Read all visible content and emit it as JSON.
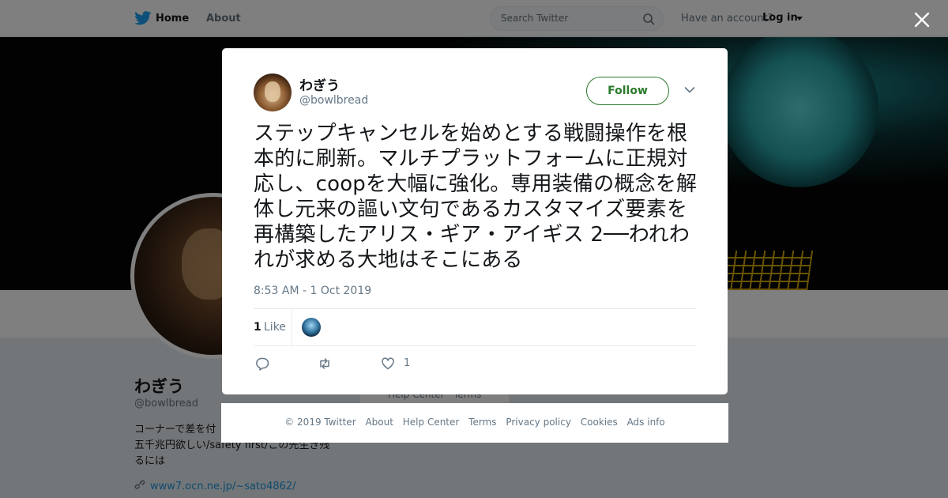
{
  "topbar": {
    "home_label": "Home",
    "about_label": "About",
    "search_placeholder": "Search Twitter",
    "account_question": "Have an account?",
    "login_label": "Log in"
  },
  "profile": {
    "name": "わぎう",
    "handle": "@bowlbread",
    "bio": "コーナーで差を付\n五千兆円欲しい/safety first/この先生き残\nるには",
    "link": "www7.ocn.ne.jp/~sato4862/",
    "card_links": "Help Center   Terms"
  },
  "tweet": {
    "author_name": "わぎう",
    "author_handle": "@bowlbread",
    "follow_label": "Follow",
    "text": "ステップキャンセルを始めとする戦闘操作を根本的に刷新。マルチプラットフォームに正規対応し、coopを大幅に強化。専用装備の概念を解体し元来の謳い文句であるカスタマイズ要素を再構築したアリス・ギア・アイギス 2──われわれが求める大地はそこにある",
    "timestamp": "8:53 AM - 1 Oct 2019",
    "like_count": "1",
    "like_label": "Like",
    "action_like_count": "1"
  },
  "footer": {
    "links": [
      "© 2019 Twitter",
      "About",
      "Help Center",
      "Terms",
      "Privacy policy",
      "Cookies",
      "Ads info"
    ]
  },
  "colors": {
    "follow_green": "#2b7a2b",
    "link_blue": "#1b95e0",
    "muted": "#657786",
    "twitter_blue": "#1da1f2"
  },
  "icons": [
    "twitter-bird-icon",
    "search-icon",
    "close-icon",
    "chevron-down-icon",
    "reply-icon",
    "retweet-icon",
    "heart-icon",
    "link-icon"
  ]
}
